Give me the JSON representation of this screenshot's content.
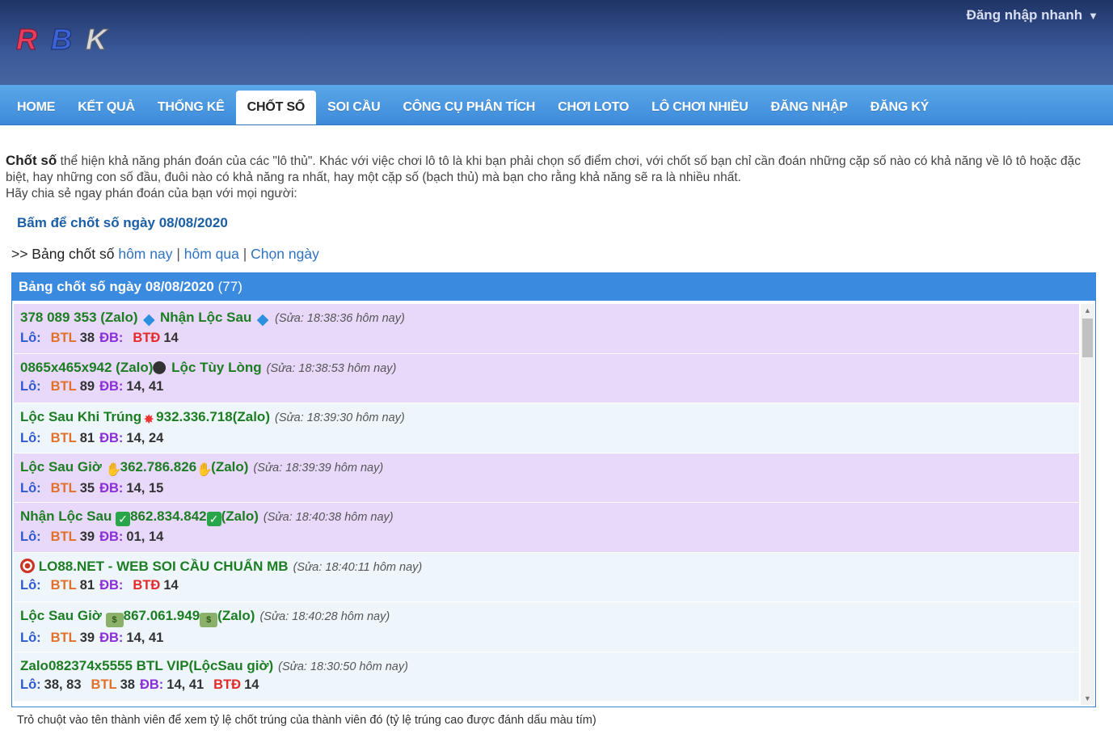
{
  "header": {
    "logo_letters": [
      "R",
      "B",
      "K"
    ],
    "quick_login": "Đăng nhập nhanh",
    "quick_login_caret": "▼"
  },
  "nav": [
    {
      "label": "HOME",
      "active": false
    },
    {
      "label": "KẾT QUẢ",
      "active": false
    },
    {
      "label": "THỐNG KÊ",
      "active": false
    },
    {
      "label": "CHỐT SỐ",
      "active": true
    },
    {
      "label": "SOI CẦU",
      "active": false
    },
    {
      "label": "CÔNG CỤ PHÂN TÍCH",
      "active": false
    },
    {
      "label": "CHƠI LOTO",
      "active": false
    },
    {
      "label": "LÔ CHƠI NHIỀU",
      "active": false
    },
    {
      "label": "ĐĂNG NHẬP",
      "active": false
    },
    {
      "label": "ĐĂNG KÝ",
      "active": false
    }
  ],
  "intro": {
    "bold": "Chốt số",
    "text": " thể hiện khả năng phán đoán của các \"lô thủ\". Khác với việc chơi lô tô là khi bạn phải chọn số điểm chơi, với chốt số bạn chỉ cần đoán những cặp số nào có khả năng về lô tô hoặc đặc biệt, hay những con số đầu, đuôi nào có khả năng ra nhất, hay một cặp số (bạch thủ) mà bạn cho rằng khả năng sẽ ra là nhiều nhất.",
    "line2": "Hãy chia sẻ ngay phán đoán của bạn với mọi người:"
  },
  "pick_link": "Bấm để chốt số ngày 08/08/2020",
  "board_links": {
    "prefix": ">> Bảng chốt số",
    "today": "hôm nay",
    "yesterday": "hôm qua",
    "choose_date": "Chọn ngày",
    "separator": "|"
  },
  "panel": {
    "title": "Bảng chốt số ngày 08/08/2020",
    "count": "(77)"
  },
  "labels": {
    "lo": "Lô:",
    "btl": "BTL",
    "db": "ĐB:",
    "btd": "BTĐ"
  },
  "entries": [
    {
      "style": "purple",
      "name_pre": "378 089 353 (Zalo) ",
      "emo1": "diamond",
      "name_mid": " Nhận Lộc Sau ",
      "emo2": "diamond",
      "name_post": "",
      "edit": "(Sửa: 18:38:36 hôm nay)",
      "lo": "",
      "btl": "38",
      "db": "",
      "btd": "14"
    },
    {
      "style": "purple",
      "name_pre": "0865x465x942 (Zalo)",
      "emo1": "bomb",
      "name_mid": " Lộc Tùy Lòng",
      "emo2": "",
      "name_post": "",
      "edit": "(Sửa: 18:38:53 hôm nay)",
      "lo": "",
      "btl": "89",
      "db": "14, 41",
      "btd": ""
    },
    {
      "style": "blue",
      "name_pre": "Lộc Sau Khi Trúng",
      "emo1": "boom",
      "name_mid": "932.336.718(Zalo)",
      "emo2": "",
      "name_post": "",
      "edit": "(Sửa: 18:39:30 hôm nay)",
      "lo": "",
      "btl": "81",
      "db": "14, 24",
      "btd": ""
    },
    {
      "style": "purple",
      "name_pre": "Lộc Sau Giờ ",
      "emo1": "ok",
      "name_mid": "362.786.826",
      "emo2": "ok",
      "name_post": "(Zalo)",
      "edit": "(Sửa: 18:39:39 hôm nay)",
      "lo": "",
      "btl": "35",
      "db": "14, 15",
      "btd": ""
    },
    {
      "style": "purple",
      "name_pre": "Nhận Lộc Sau ",
      "emo1": "check",
      "name_mid": "862.834.842",
      "emo2": "check",
      "name_post": "(Zalo)",
      "edit": "(Sửa: 18:40:38 hôm nay)",
      "lo": "",
      "btl": "39",
      "db": "01, 14",
      "btd": ""
    },
    {
      "style": "blue",
      "name_pre": "",
      "emo1": "target",
      "name_mid": " LO88.NET - WEB SOI CẦU CHUẨN MB",
      "emo2": "",
      "name_post": "",
      "edit": "(Sửa: 18:40:11 hôm nay)",
      "lo": "",
      "btl": "81",
      "db": "",
      "btd": "14"
    },
    {
      "style": "blue",
      "name_pre": "Lộc Sau Giờ ",
      "emo1": "cash",
      "name_mid": "867.061.949",
      "emo2": "cash",
      "name_post": "(Zalo)",
      "edit": "(Sửa: 18:40:28 hôm nay)",
      "lo": "",
      "btl": "39",
      "db": "14, 41",
      "btd": ""
    },
    {
      "style": "blue",
      "name_pre": "Zalo082374x5555 BTL VIP(LộcSau giờ)",
      "emo1": "",
      "name_mid": "",
      "emo2": "",
      "name_post": "",
      "edit": "(Sửa: 18:30:50 hôm nay)",
      "lo": "38, 83",
      "btl": "38",
      "db": "14, 41",
      "btd": "14"
    }
  ],
  "icons": {
    "diamond": "diamond-icon",
    "bomb": "bomb-icon",
    "boom": "explosion-icon",
    "ok": "ok-hand-icon",
    "check": "check-mark-icon",
    "target": "target-icon",
    "cash": "money-icon"
  },
  "colors": {
    "header_bg": "#2b4580",
    "nav_bg": "#4a97e2",
    "panel_head": "#3a8ae0",
    "name_green": "#1c7d22",
    "row_purple": "#e8d9fa",
    "row_blue": "#eef6fc"
  },
  "footnote": "Trỏ chuột vào tên thành viên để xem tỷ lệ chốt trúng của thành viên đó (tỷ lệ trúng cao được đánh dấu màu tím)"
}
